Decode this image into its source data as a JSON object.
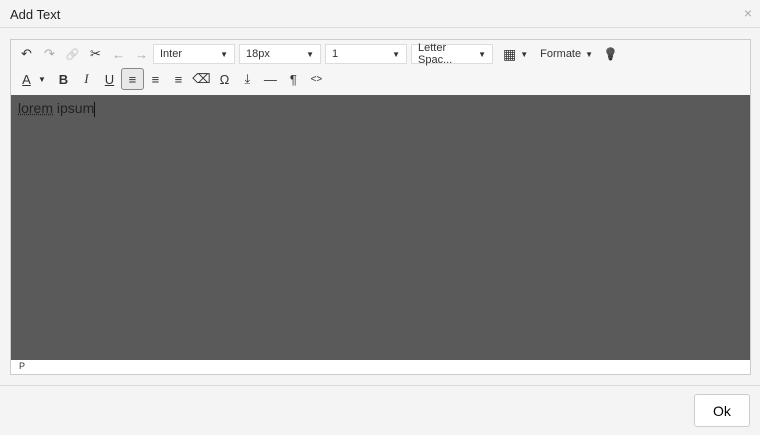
{
  "dialog": {
    "title": "Add Text",
    "close": "×",
    "ok": "Ok"
  },
  "toolbar": {
    "font": "Inter",
    "size": "18px",
    "line_height": "1",
    "letter_spacing": "Letter Spac...",
    "formats": "Formate",
    "caret": "▼"
  },
  "icons": {
    "undo": "↶",
    "redo": "↷",
    "link": "🔗",
    "unlink": "✂",
    "ltr": "←",
    "rtl": "→",
    "table": "▦",
    "bulb": "💡",
    "fontcolor": "A",
    "bold": "B",
    "italic": "I",
    "underline": "U",
    "left": "≡",
    "center": "≡",
    "right": "≡",
    "eraser": "⌫",
    "omega": "Ω",
    "insert": "⤓",
    "hr": "—",
    "pilcrow": "¶",
    "code": "<>"
  },
  "content": {
    "word1": "lorem",
    "word2": " ipsum"
  },
  "status": {
    "path": "P"
  }
}
